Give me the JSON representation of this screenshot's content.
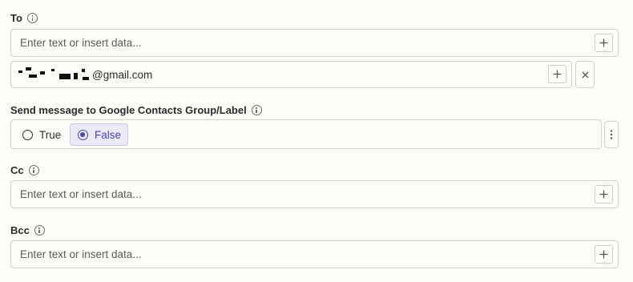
{
  "to": {
    "label": "To",
    "placeholder": "Enter text or insert data...",
    "recipient_domain": "@gmail.com"
  },
  "group_option": {
    "label": "Send message to Google Contacts Group/Label",
    "options": [
      {
        "label": "True",
        "selected": false
      },
      {
        "label": "False",
        "selected": true
      }
    ]
  },
  "cc": {
    "label": "Cc",
    "placeholder": "Enter text or insert data..."
  },
  "bcc": {
    "label": "Bcc",
    "placeholder": "Enter text or insert data..."
  },
  "colors": {
    "background": "#fffdf9",
    "border": "#d4d2cd",
    "accent": "#4a44b8",
    "accent_bg": "#eceaf8"
  }
}
